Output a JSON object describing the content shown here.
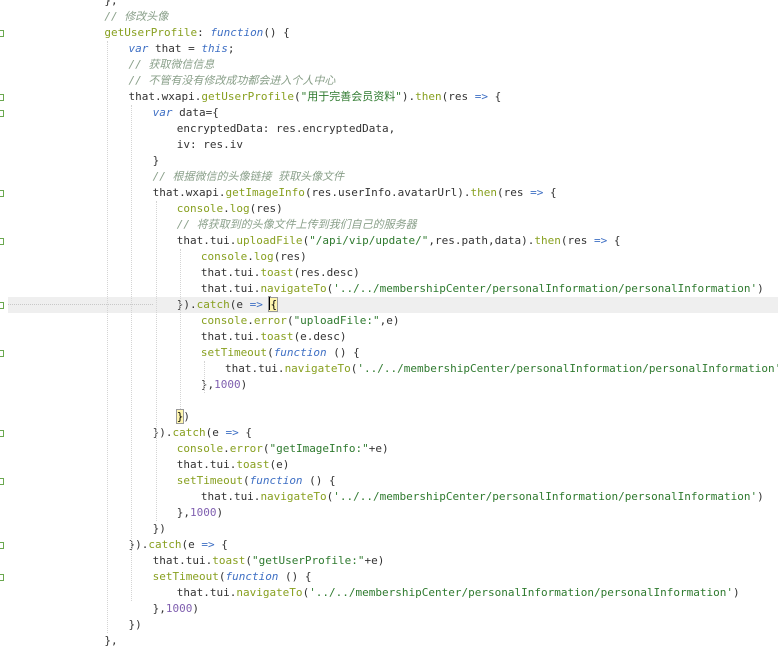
{
  "editor": {
    "lines": [
      {
        "indent": 6,
        "tokens": [
          {
            "c": "id",
            "t": "},"
          }
        ]
      },
      {
        "indent": 6,
        "fold": false,
        "tokens": [
          {
            "c": "cmt",
            "t": "// 修改头像"
          }
        ]
      },
      {
        "indent": 6,
        "fold": true,
        "tokens": [
          {
            "c": "fn",
            "t": "getUserProfile"
          },
          {
            "c": "id",
            "t": ": "
          },
          {
            "c": "kw",
            "t": "function"
          },
          {
            "c": "id",
            "t": "() {"
          }
        ]
      },
      {
        "indent": 8,
        "tokens": [
          {
            "c": "kw",
            "t": "var"
          },
          {
            "c": "id",
            "t": " that = "
          },
          {
            "c": "kw",
            "t": "this"
          },
          {
            "c": "id",
            "t": ";"
          }
        ]
      },
      {
        "indent": 8,
        "tokens": [
          {
            "c": "cmt",
            "t": "// 获取微信信息"
          }
        ]
      },
      {
        "indent": 8,
        "tokens": [
          {
            "c": "cmt",
            "t": "// 不管有没有修改成功都会进入个人中心"
          }
        ]
      },
      {
        "indent": 8,
        "fold": true,
        "tokens": [
          {
            "c": "id",
            "t": "that.wxapi."
          },
          {
            "c": "fn",
            "t": "getUserProfile"
          },
          {
            "c": "id",
            "t": "("
          },
          {
            "c": "str",
            "t": "\"用于完善会员资料\""
          },
          {
            "c": "id",
            "t": ")."
          },
          {
            "c": "fn",
            "t": "then"
          },
          {
            "c": "id",
            "t": "(res "
          },
          {
            "c": "op",
            "t": "=>"
          },
          {
            "c": "id",
            "t": " {"
          }
        ]
      },
      {
        "indent": 10,
        "fold": true,
        "tokens": [
          {
            "c": "kw",
            "t": "var"
          },
          {
            "c": "id",
            "t": " data={"
          }
        ]
      },
      {
        "indent": 12,
        "tokens": [
          {
            "c": "id",
            "t": "encryptedData: res.encryptedData,"
          }
        ]
      },
      {
        "indent": 12,
        "tokens": [
          {
            "c": "id",
            "t": "iv: res.iv"
          }
        ]
      },
      {
        "indent": 10,
        "tokens": [
          {
            "c": "id",
            "t": "}"
          }
        ]
      },
      {
        "indent": 10,
        "tokens": [
          {
            "c": "cmt",
            "t": "// 根据微信的头像链接 获取头像文件"
          }
        ]
      },
      {
        "indent": 10,
        "fold": true,
        "tokens": [
          {
            "c": "id",
            "t": "that.wxapi."
          },
          {
            "c": "fn",
            "t": "getImageInfo"
          },
          {
            "c": "id",
            "t": "(res.userInfo.avatarUrl)."
          },
          {
            "c": "fn",
            "t": "then"
          },
          {
            "c": "id",
            "t": "(res "
          },
          {
            "c": "op",
            "t": "=>"
          },
          {
            "c": "id",
            "t": " {"
          }
        ]
      },
      {
        "indent": 12,
        "tokens": [
          {
            "c": "fn",
            "t": "console"
          },
          {
            "c": "id",
            "t": "."
          },
          {
            "c": "fn",
            "t": "log"
          },
          {
            "c": "id",
            "t": "(res)"
          }
        ]
      },
      {
        "indent": 12,
        "tokens": [
          {
            "c": "cmt",
            "t": "// 将获取到的头像文件上传到我们自己的服务器"
          }
        ]
      },
      {
        "indent": 12,
        "fold": true,
        "tokens": [
          {
            "c": "id",
            "t": "that.tui."
          },
          {
            "c": "fn",
            "t": "uploadFile"
          },
          {
            "c": "id",
            "t": "("
          },
          {
            "c": "str",
            "t": "\"/api/vip/update/\""
          },
          {
            "c": "id",
            "t": ",res.path,data)."
          },
          {
            "c": "fn",
            "t": "then"
          },
          {
            "c": "id",
            "t": "(res "
          },
          {
            "c": "op",
            "t": "=>"
          },
          {
            "c": "id",
            "t": " {"
          }
        ]
      },
      {
        "indent": 14,
        "tokens": [
          {
            "c": "fn",
            "t": "console"
          },
          {
            "c": "id",
            "t": "."
          },
          {
            "c": "fn",
            "t": "log"
          },
          {
            "c": "id",
            "t": "(res)"
          }
        ]
      },
      {
        "indent": 14,
        "tokens": [
          {
            "c": "id",
            "t": "that.tui."
          },
          {
            "c": "fn",
            "t": "toast"
          },
          {
            "c": "id",
            "t": "(res.desc)"
          }
        ]
      },
      {
        "indent": 14,
        "tokens": [
          {
            "c": "id",
            "t": "that.tui."
          },
          {
            "c": "fn",
            "t": "navigateTo"
          },
          {
            "c": "id",
            "t": "("
          },
          {
            "c": "str",
            "t": "'../../membershipCenter/personalInformation/personalInformation'"
          },
          {
            "c": "id",
            "t": ")"
          }
        ]
      },
      {
        "indent": 12,
        "fold": true,
        "current": true,
        "tokens": [
          {
            "c": "id",
            "t": "})."
          },
          {
            "c": "fn",
            "t": "catch"
          },
          {
            "c": "id",
            "t": "(e "
          },
          {
            "c": "op",
            "t": "=>"
          },
          {
            "c": "id",
            "t": " "
          },
          {
            "c": "bh",
            "t": "{"
          }
        ]
      },
      {
        "indent": 14,
        "tokens": [
          {
            "c": "fn",
            "t": "console"
          },
          {
            "c": "id",
            "t": "."
          },
          {
            "c": "fn",
            "t": "error"
          },
          {
            "c": "id",
            "t": "("
          },
          {
            "c": "str",
            "t": "\"uploadFile:\""
          },
          {
            "c": "id",
            "t": ",e)"
          }
        ]
      },
      {
        "indent": 14,
        "tokens": [
          {
            "c": "id",
            "t": "that.tui."
          },
          {
            "c": "fn",
            "t": "toast"
          },
          {
            "c": "id",
            "t": "(e.desc)"
          }
        ]
      },
      {
        "indent": 14,
        "fold": true,
        "tokens": [
          {
            "c": "fn",
            "t": "setTimeout"
          },
          {
            "c": "id",
            "t": "("
          },
          {
            "c": "kw",
            "t": "function"
          },
          {
            "c": "id",
            "t": " () {"
          }
        ]
      },
      {
        "indent": 16,
        "tokens": [
          {
            "c": "id",
            "t": "that.tui."
          },
          {
            "c": "fn",
            "t": "navigateTo"
          },
          {
            "c": "id",
            "t": "("
          },
          {
            "c": "str",
            "t": "'../../membershipCenter/personalInformation/personalInformation'"
          },
          {
            "c": "id",
            "t": ")"
          }
        ]
      },
      {
        "indent": 14,
        "tokens": [
          {
            "c": "id",
            "t": "},"
          },
          {
            "c": "num",
            "t": "1000"
          },
          {
            "c": "id",
            "t": ")"
          }
        ]
      },
      {
        "indent": 14,
        "tokens": []
      },
      {
        "indent": 12,
        "tokens": [
          {
            "c": "bh",
            "t": "}"
          },
          {
            "c": "id",
            "t": ")"
          }
        ]
      },
      {
        "indent": 10,
        "fold": true,
        "tokens": [
          {
            "c": "id",
            "t": "})."
          },
          {
            "c": "fn",
            "t": "catch"
          },
          {
            "c": "id",
            "t": "(e "
          },
          {
            "c": "op",
            "t": "=>"
          },
          {
            "c": "id",
            "t": " {"
          }
        ]
      },
      {
        "indent": 12,
        "tokens": [
          {
            "c": "fn",
            "t": "console"
          },
          {
            "c": "id",
            "t": "."
          },
          {
            "c": "fn",
            "t": "error"
          },
          {
            "c": "id",
            "t": "("
          },
          {
            "c": "str",
            "t": "\"getImageInfo:\""
          },
          {
            "c": "id",
            "t": "+e)"
          }
        ]
      },
      {
        "indent": 12,
        "tokens": [
          {
            "c": "id",
            "t": "that.tui."
          },
          {
            "c": "fn",
            "t": "toast"
          },
          {
            "c": "id",
            "t": "(e)"
          }
        ]
      },
      {
        "indent": 12,
        "fold": true,
        "tokens": [
          {
            "c": "fn",
            "t": "setTimeout"
          },
          {
            "c": "id",
            "t": "("
          },
          {
            "c": "kw",
            "t": "function"
          },
          {
            "c": "id",
            "t": " () {"
          }
        ]
      },
      {
        "indent": 14,
        "tokens": [
          {
            "c": "id",
            "t": "that.tui."
          },
          {
            "c": "fn",
            "t": "navigateTo"
          },
          {
            "c": "id",
            "t": "("
          },
          {
            "c": "str",
            "t": "'../../membershipCenter/personalInformation/personalInformation'"
          },
          {
            "c": "id",
            "t": ")"
          }
        ]
      },
      {
        "indent": 12,
        "tokens": [
          {
            "c": "id",
            "t": "},"
          },
          {
            "c": "num",
            "t": "1000"
          },
          {
            "c": "id",
            "t": ")"
          }
        ]
      },
      {
        "indent": 10,
        "tokens": [
          {
            "c": "id",
            "t": "})"
          }
        ]
      },
      {
        "indent": 8,
        "fold": true,
        "tokens": [
          {
            "c": "id",
            "t": "})."
          },
          {
            "c": "fn",
            "t": "catch"
          },
          {
            "c": "id",
            "t": "(e "
          },
          {
            "c": "op",
            "t": "=>"
          },
          {
            "c": "id",
            "t": " {"
          }
        ]
      },
      {
        "indent": 10,
        "tokens": [
          {
            "c": "id",
            "t": "that.tui."
          },
          {
            "c": "fn",
            "t": "toast"
          },
          {
            "c": "id",
            "t": "("
          },
          {
            "c": "str",
            "t": "\"getUserProfile:\""
          },
          {
            "c": "id",
            "t": "+e)"
          }
        ]
      },
      {
        "indent": 10,
        "fold": true,
        "tokens": [
          {
            "c": "fn",
            "t": "setTimeout"
          },
          {
            "c": "id",
            "t": "("
          },
          {
            "c": "kw",
            "t": "function"
          },
          {
            "c": "id",
            "t": " () {"
          }
        ]
      },
      {
        "indent": 12,
        "tokens": [
          {
            "c": "id",
            "t": "that.tui."
          },
          {
            "c": "fn",
            "t": "navigateTo"
          },
          {
            "c": "id",
            "t": "("
          },
          {
            "c": "str",
            "t": "'../../membershipCenter/personalInformation/personalInformation'"
          },
          {
            "c": "id",
            "t": ")"
          }
        ]
      },
      {
        "indent": 10,
        "tokens": [
          {
            "c": "id",
            "t": "},"
          },
          {
            "c": "num",
            "t": "1000"
          },
          {
            "c": "id",
            "t": ")"
          }
        ]
      },
      {
        "indent": 8,
        "tokens": [
          {
            "c": "id",
            "t": "})"
          }
        ]
      },
      {
        "indent": 6,
        "tokens": [
          {
            "c": "id",
            "t": "},"
          }
        ]
      }
    ]
  }
}
